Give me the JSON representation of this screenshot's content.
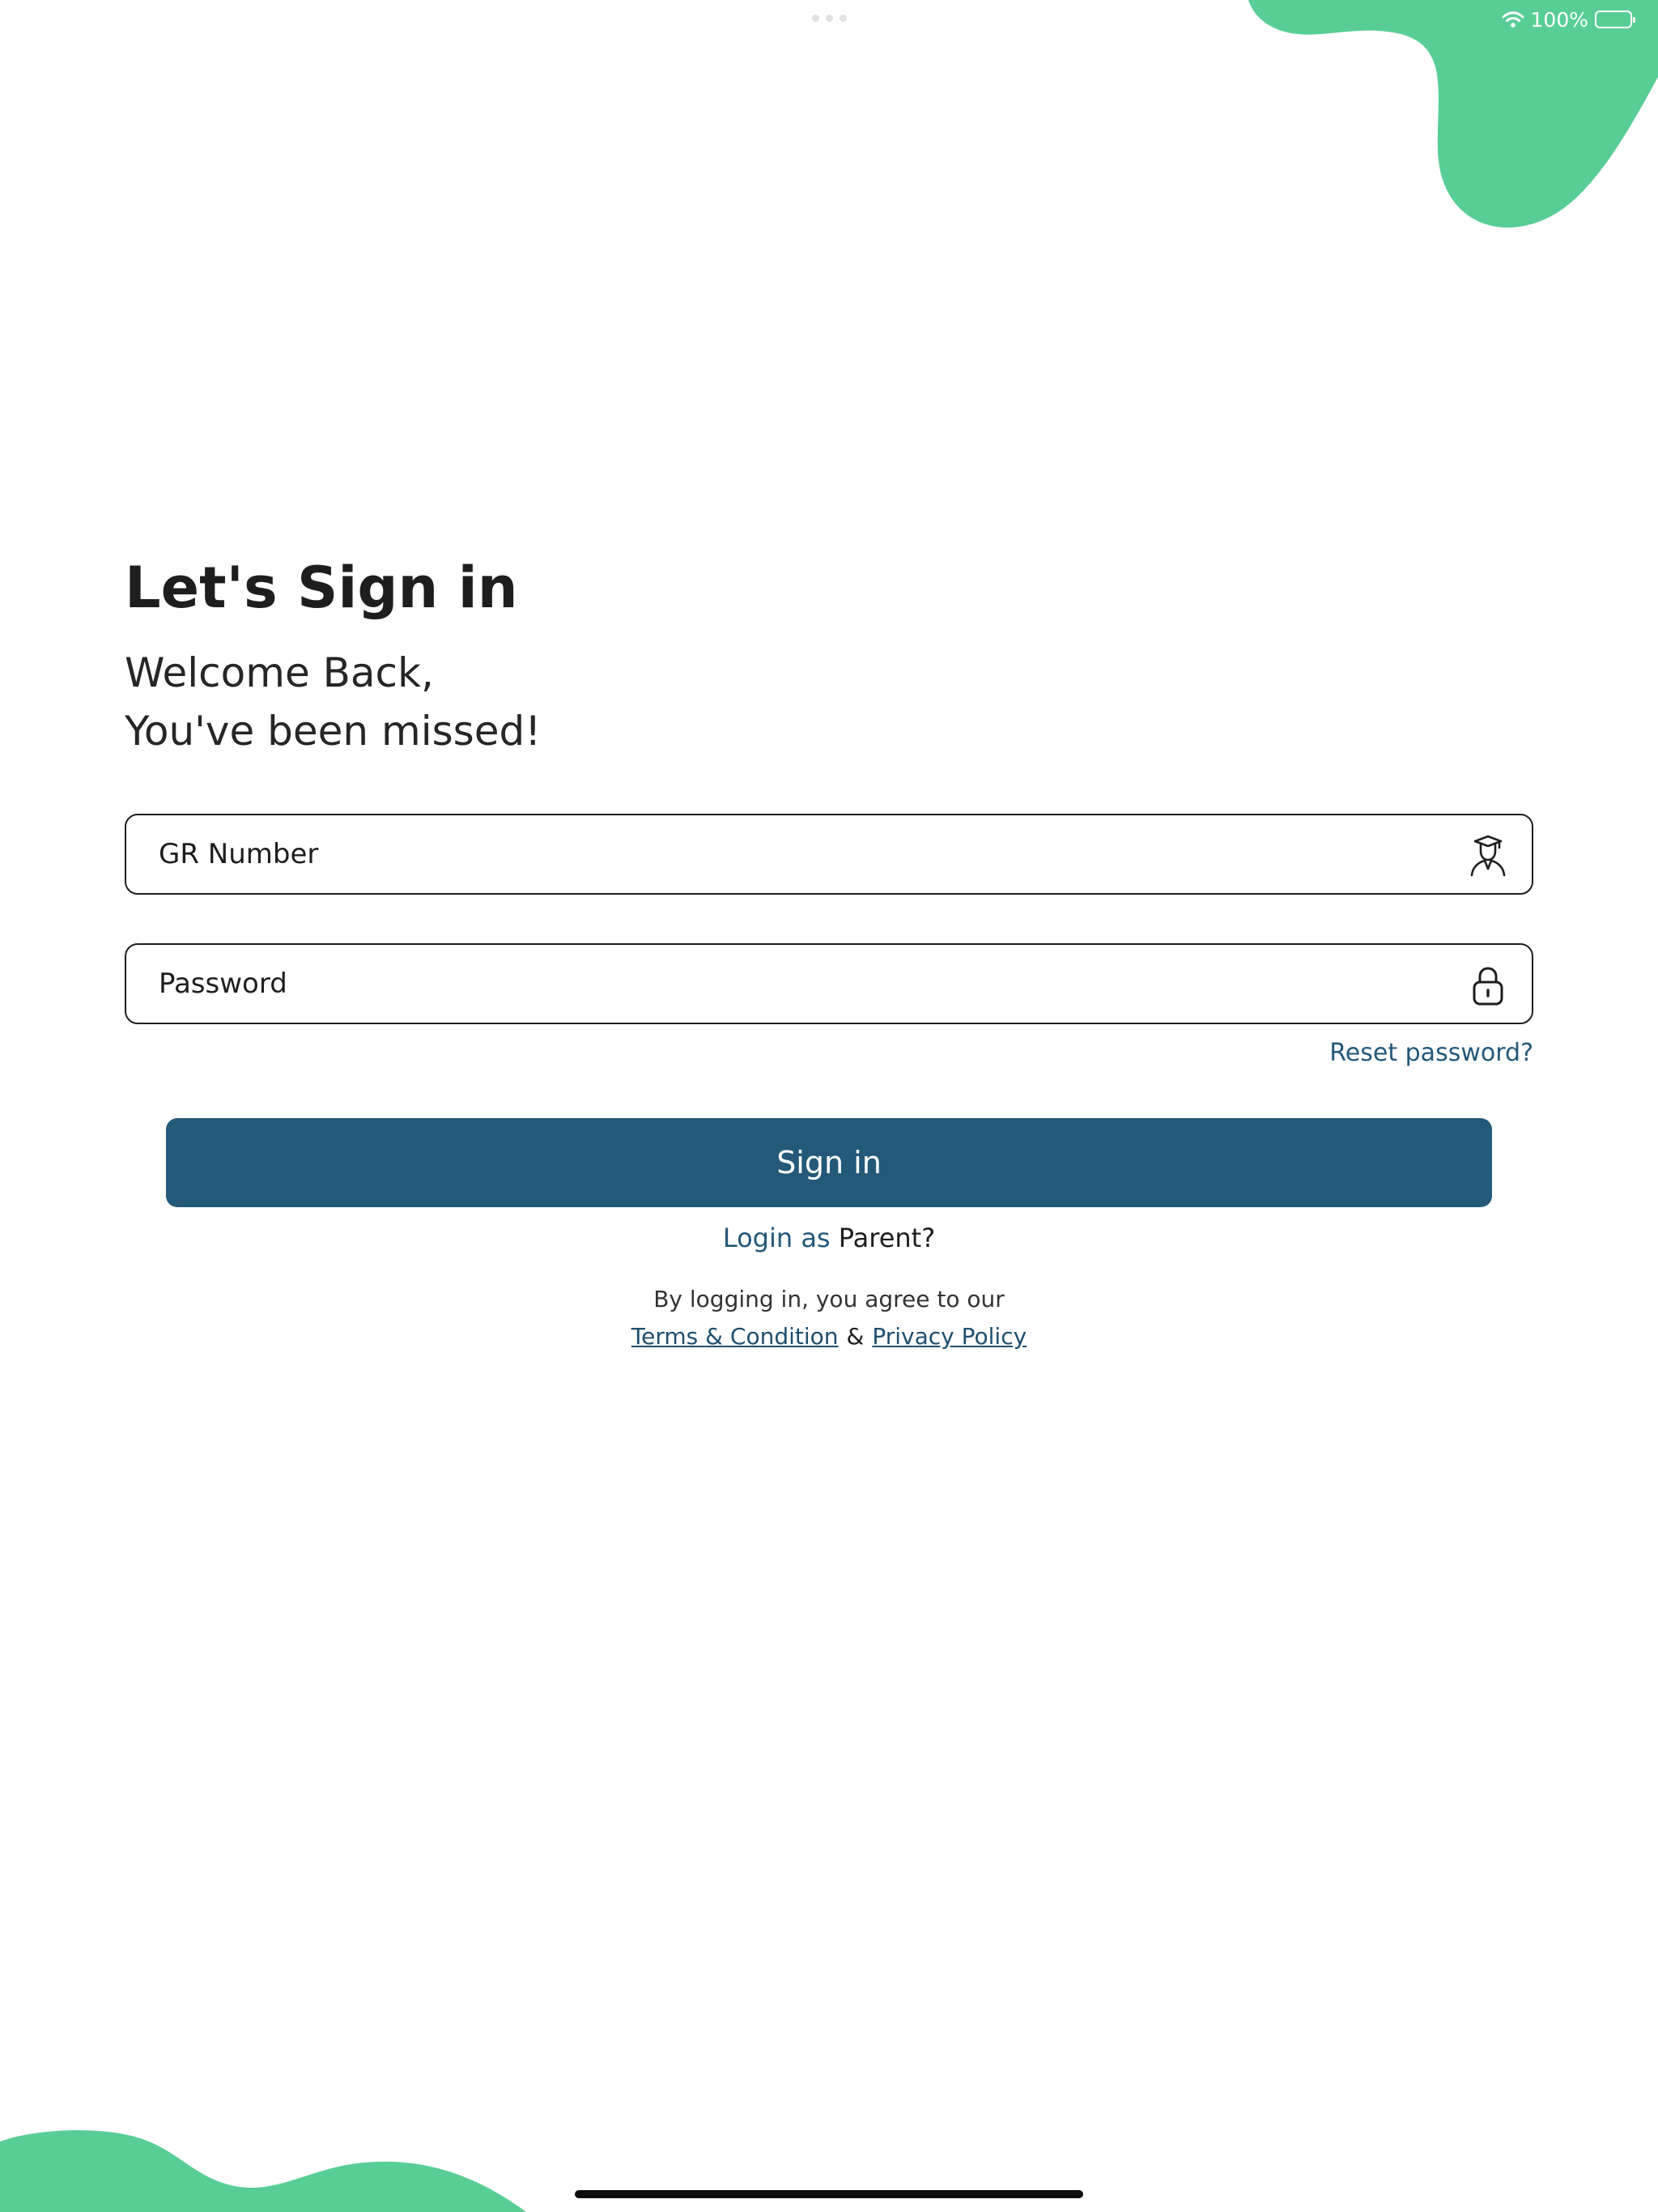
{
  "status_bar": {
    "battery_percent": "100%"
  },
  "login": {
    "title": "Let's Sign in",
    "subtitle_line1": "Welcome Back,",
    "subtitle_line2": "You've been missed!",
    "gr_field": {
      "placeholder": "GR Number",
      "value": "",
      "icon": "student-icon"
    },
    "password_field": {
      "placeholder": "Password",
      "value": "",
      "icon": "lock-icon"
    },
    "reset_password": "Reset password?",
    "sign_in_button": "Sign in",
    "login_as": "Login as",
    "parent": "Parent?",
    "agreement_text": "By logging in, you agree to our",
    "terms_link": "Terms & Condition",
    "ampersand": "&",
    "privacy_link": "Privacy Policy"
  },
  "colors": {
    "accent_green": "#58CE96",
    "primary_blue": "#235979",
    "link_blue": "#23587A"
  }
}
